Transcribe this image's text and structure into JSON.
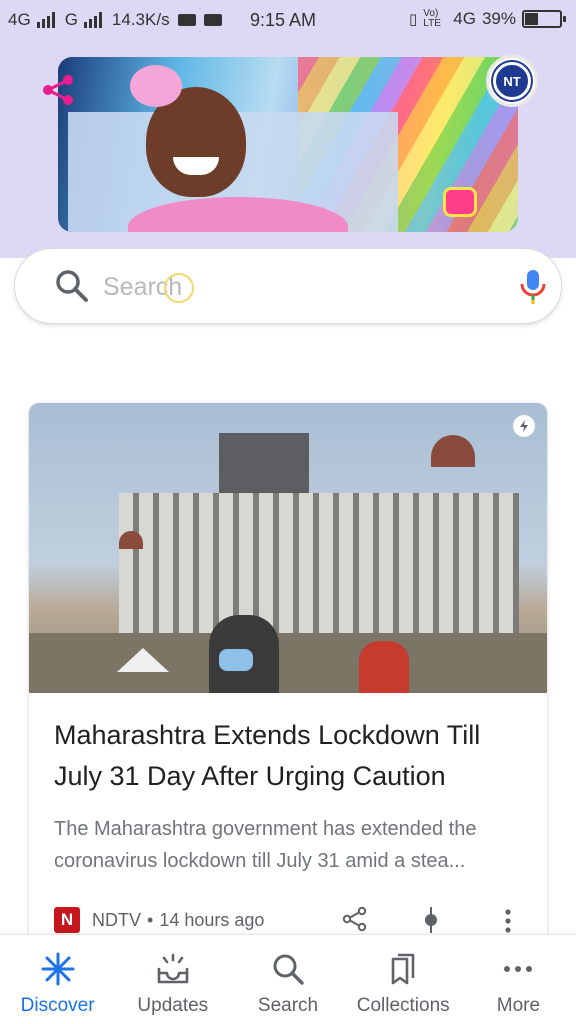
{
  "status_bar": {
    "network_1": "4G",
    "network_2": "G",
    "speed": "14.3K/s",
    "time": "9:15 AM",
    "volte": "Vo) LTE",
    "network_3": "4G",
    "battery": "39%",
    "battery_level": 0.39
  },
  "doodle": {
    "account_initials": "NT"
  },
  "search": {
    "placeholder": "Search",
    "value": ""
  },
  "card": {
    "title": "Maharashtra Extends Lockdown Till July 31 Day After Urging Caution",
    "snippet": "The Maharashtra government has extended the coronavirus lockdown till July 31 amid a stea...",
    "source_logo": "N",
    "source": "NDTV",
    "separator": "•",
    "time_ago": "14 hours ago"
  },
  "bottom_nav": {
    "items": [
      {
        "label": "Discover",
        "icon": "asterisk-icon",
        "active": true
      },
      {
        "label": "Updates",
        "icon": "updates-tray-icon",
        "active": false
      },
      {
        "label": "Search",
        "icon": "search-icon",
        "active": false
      },
      {
        "label": "Collections",
        "icon": "bookmarks-icon",
        "active": false
      },
      {
        "label": "More",
        "icon": "more-horizontal-icon",
        "active": false
      }
    ]
  },
  "colors": {
    "header_bg": "#ddd8f3",
    "accent": "#1a73e8",
    "text_primary": "#202124",
    "text_secondary": "#70757a",
    "ndtv_red": "#c4161c"
  }
}
